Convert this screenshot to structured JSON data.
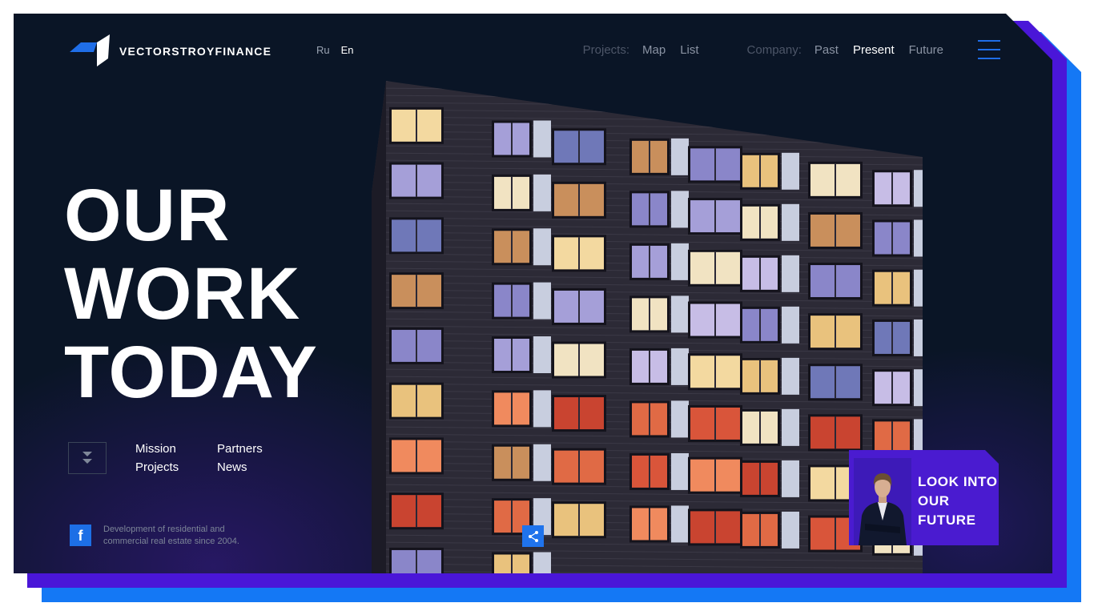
{
  "brand": {
    "name": "VECTORSTROYFINANCE"
  },
  "languages": [
    {
      "label": "Ru",
      "active": false
    },
    {
      "label": "En",
      "active": true
    }
  ],
  "nav": {
    "projects_label": "Projects:",
    "projects_links": [
      "Map",
      "List"
    ],
    "company_label": "Company:",
    "company_links": [
      "Past",
      "Present",
      "Future"
    ],
    "active_link": "Present"
  },
  "hero": {
    "lines": [
      "OUR",
      "WORK",
      "TODAY"
    ]
  },
  "quick_links": [
    "Mission",
    "Partners",
    "Projects",
    "News"
  ],
  "footer": {
    "tagline": "Development of residential and commercial real estate since 2004."
  },
  "video_card": {
    "lines": [
      "LOOK INTO",
      "OUR",
      "FUTURE"
    ]
  },
  "icons": {
    "menu": "hamburger-icon",
    "scroll": "double-chevron-down-icon",
    "social": "facebook-icon",
    "share": "share-icon"
  },
  "colors": {
    "background": "#0a1526",
    "accent_blue": "#1478f5",
    "accent_violet": "#4a16d8",
    "text": "#ffffff"
  }
}
